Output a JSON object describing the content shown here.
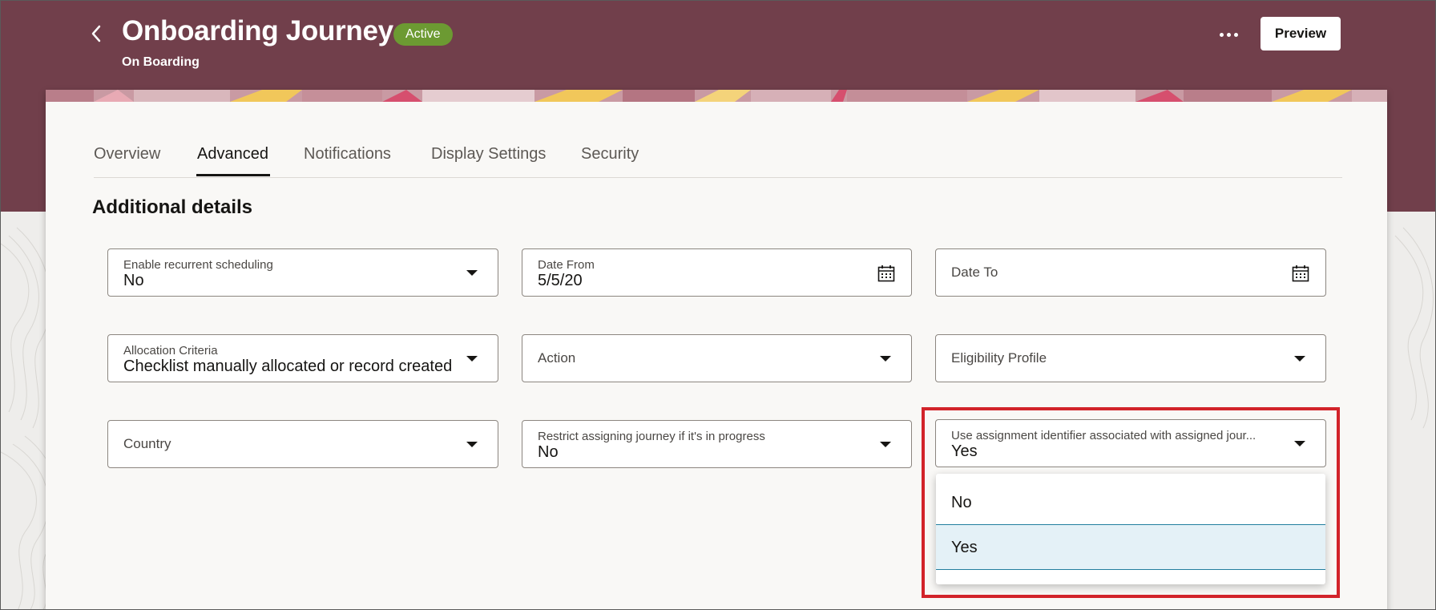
{
  "header": {
    "title": "Onboarding Journey",
    "status_badge": "Active",
    "subtitle": "On Boarding",
    "preview_label": "Preview",
    "more_icon": "ellipsis-icon",
    "back_icon": "chevron-left-icon"
  },
  "tabs": [
    {
      "label": "Overview",
      "active": false
    },
    {
      "label": "Advanced",
      "active": true
    },
    {
      "label": "Notifications",
      "active": false
    },
    {
      "label": "Display Settings",
      "active": false
    },
    {
      "label": "Security",
      "active": false
    }
  ],
  "section": {
    "title": "Additional details"
  },
  "fields": {
    "recurrent": {
      "label": "Enable recurrent scheduling",
      "value": "No",
      "icon": "chevron-down-icon"
    },
    "date_from": {
      "label": "Date From",
      "value": "5/5/20",
      "icon": "calendar-icon"
    },
    "date_to": {
      "label": "Date To",
      "value": "",
      "icon": "calendar-icon"
    },
    "allocation": {
      "label": "Allocation Criteria",
      "value": "Checklist manually allocated or record created",
      "icon": "chevron-down-icon"
    },
    "action": {
      "label": "Action",
      "value": "",
      "icon": "chevron-down-icon"
    },
    "eligibility": {
      "label": "Eligibility Profile",
      "value": "",
      "icon": "chevron-down-icon"
    },
    "country": {
      "label": "Country",
      "value": "",
      "icon": "chevron-down-icon"
    },
    "restrict": {
      "label": "Restrict assigning journey if it's in progress",
      "value": "No",
      "icon": "chevron-down-icon"
    },
    "use_assignment": {
      "label": "Use assignment identifier associated with assigned jour...",
      "value": "Yes",
      "icon": "chevron-down-icon"
    }
  },
  "dropdown": {
    "options": [
      "No",
      "Yes"
    ],
    "selected": "Yes"
  },
  "colors": {
    "header_bg": "#713f4b",
    "badge_bg": "#6c9a32",
    "highlight_border": "#d2232a",
    "selected_option_bg": "#e4f1f7"
  }
}
